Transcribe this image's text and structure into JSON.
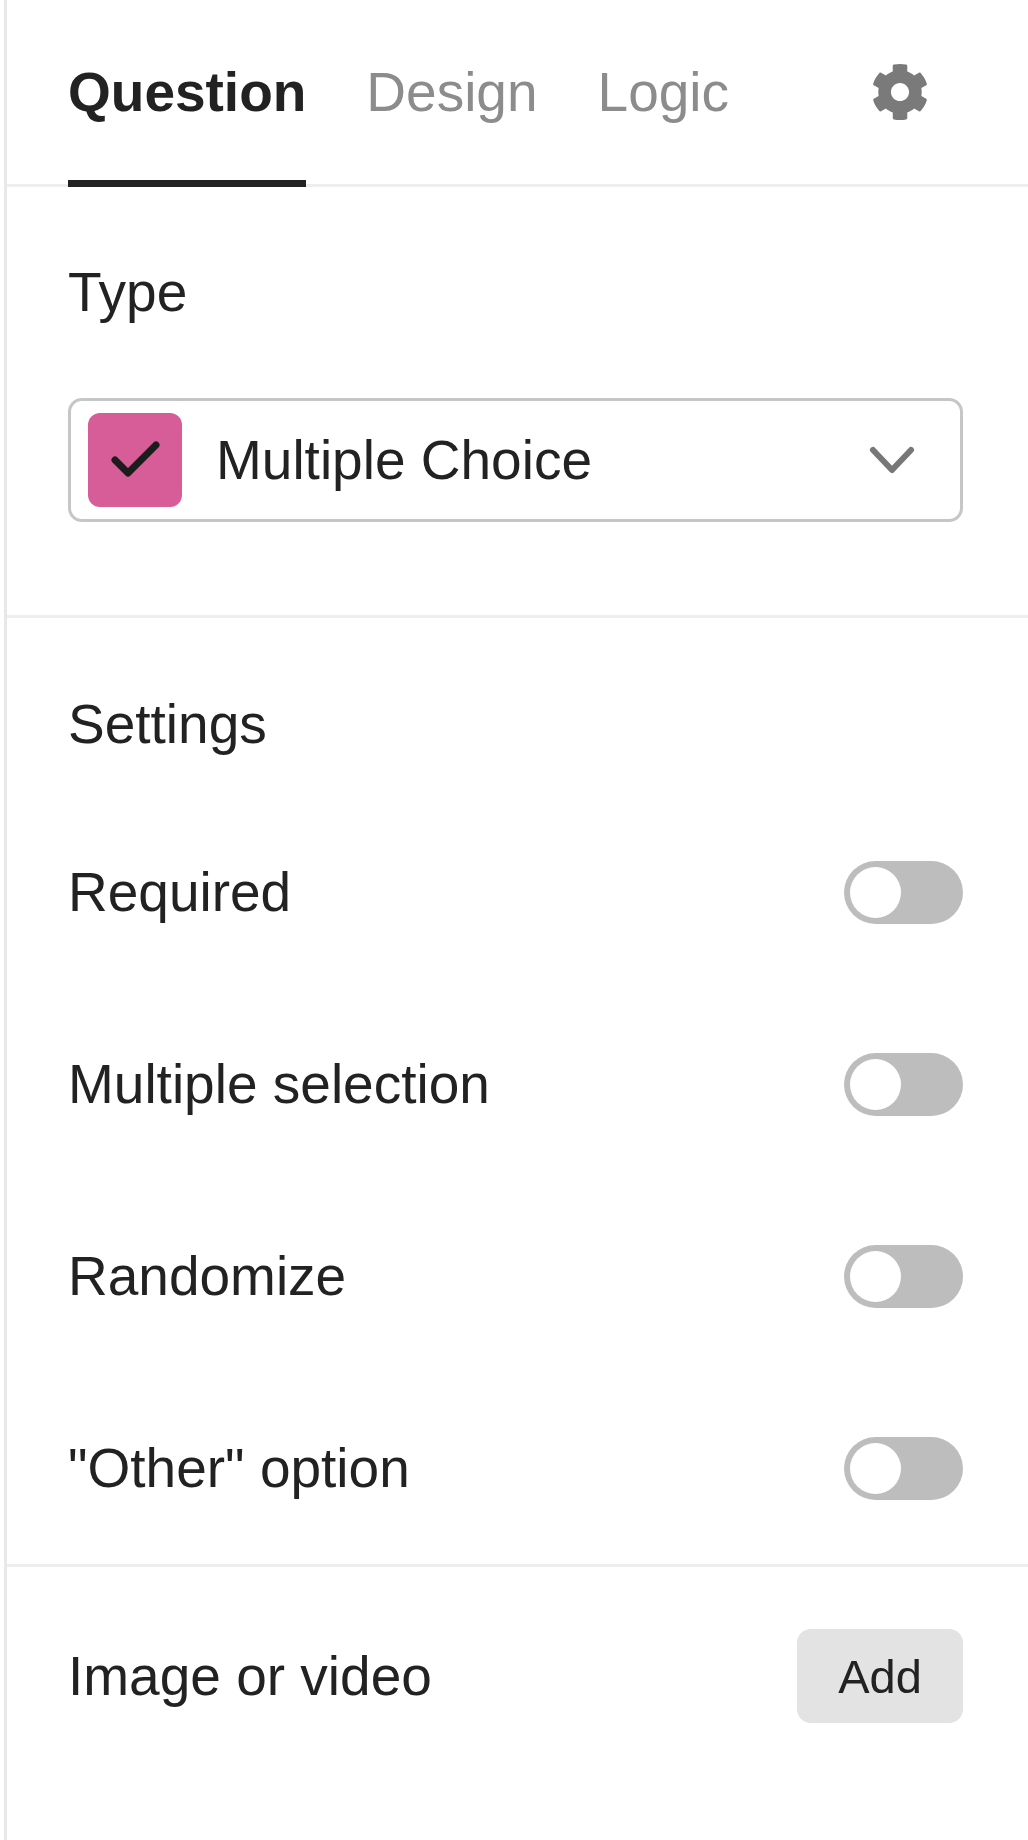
{
  "tabs": [
    {
      "label": "Question",
      "selected": true
    },
    {
      "label": "Design",
      "selected": false
    },
    {
      "label": "Logic",
      "selected": false
    }
  ],
  "type_section": {
    "heading": "Type",
    "select": {
      "value": "Multiple Choice"
    }
  },
  "settings": {
    "heading": "Settings",
    "toggles": [
      {
        "label": "Required",
        "on": false
      },
      {
        "label": "Multiple selection",
        "on": false
      },
      {
        "label": "Randomize",
        "on": false
      },
      {
        "label": "\"Other\" option",
        "on": false
      }
    ]
  },
  "media": {
    "label": "Image or video",
    "button": "Add"
  }
}
